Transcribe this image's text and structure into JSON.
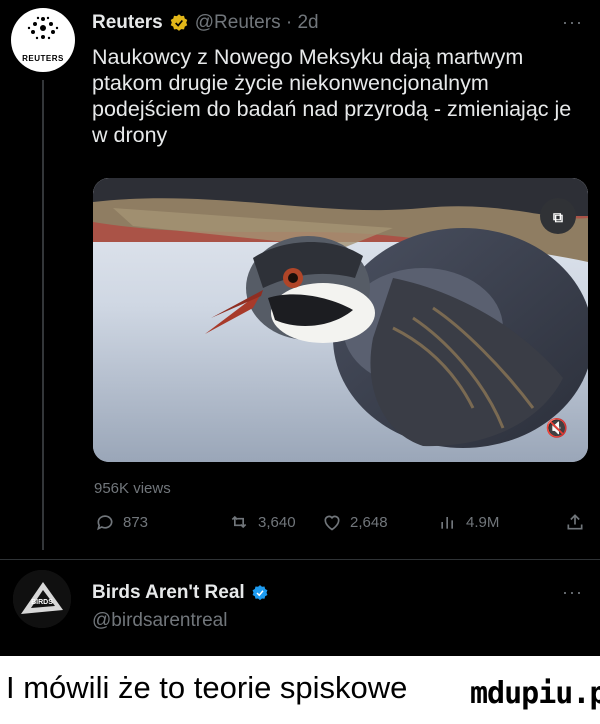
{
  "tweet1": {
    "author_name": "Reuters",
    "handle_time": "@Reuters · 2d",
    "avatar_text": "REUTERS",
    "body": "Naukowcy z Nowego Meksyku dają martwym ptakom drugie życie niekonwencjonalnym podejściem do badań nad przyrodą - zmieniając je w drony",
    "views": "956K views",
    "replies": "873",
    "retweets": "3,640",
    "likes": "2,648",
    "analytics": "4.9M"
  },
  "tweet2": {
    "author_name": "Birds Aren't Real",
    "handle": "@birdsarentreal"
  },
  "caption": "I mówili że to teorie spiskowe",
  "watermark": "mdupiu.pl",
  "colors": {
    "background": "#000000",
    "text": "#e7e9ea",
    "muted": "#71767b",
    "verified": "#1d9bf0",
    "gold_badge": "#e2b719"
  }
}
